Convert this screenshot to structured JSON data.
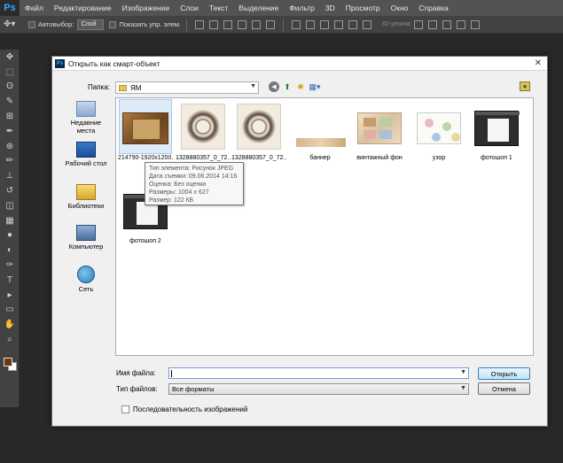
{
  "app": {
    "logo": "Ps",
    "menu": [
      "Файл",
      "Редактирование",
      "Изображение",
      "Слои",
      "Текст",
      "Выделение",
      "Фильтр",
      "3D",
      "Просмотр",
      "Окно",
      "Справка"
    ]
  },
  "options_bar": {
    "auto_select_label": "Автовыбор:",
    "auto_select_value": "Слой",
    "show_controls_label": "Показать упр. элем.",
    "mode_3d_label": "3D-режим:"
  },
  "tools": [
    "move-tool",
    "marquee-tool",
    "lasso-tool",
    "quick-select-tool",
    "crop-tool",
    "eyedropper-tool",
    "healing-tool",
    "brush-tool",
    "stamp-tool",
    "history-brush-tool",
    "eraser-tool",
    "gradient-tool",
    "blur-tool",
    "dodge-tool",
    "pen-tool",
    "type-tool",
    "path-select-tool",
    "shape-tool",
    "hand-tool",
    "zoom-tool"
  ],
  "tool_glyphs": [
    "✥",
    "⬚",
    "ʘ",
    "✎",
    "⊞",
    "✒",
    "⊕",
    "✏",
    "⊥",
    "↺",
    "◫",
    "▦",
    "●",
    "◐",
    "✑",
    "T",
    "▸",
    "▭",
    "✋",
    "⌕"
  ],
  "colors": {
    "foreground": "#6b3a10",
    "background": "#ffffff"
  },
  "dialog": {
    "title": "Открыть как смарт-объект",
    "folder_label": "Папка:",
    "folder_value": "ЯМ",
    "places": [
      {
        "label_line1": "Недавние",
        "label_line2": "места"
      },
      {
        "label_line1": "Рабочий стол",
        "label_line2": ""
      },
      {
        "label_line1": "Библиотеки",
        "label_line2": ""
      },
      {
        "label_line1": "Компьютер",
        "label_line2": ""
      },
      {
        "label_line1": "Сеть",
        "label_line2": ""
      }
    ],
    "files": [
      "214790-1920x1200...",
      "1328880357_0_72...",
      "1328880357_0_72...",
      "баннер",
      "винтажный фон",
      "узор",
      "фотошоп 1",
      "фотошоп 2"
    ],
    "tooltip": {
      "type": "Тип элемента: Рисунок JPEG",
      "date": "Дата съемки: 09.06.2014 14:16",
      "rating": "Оценка: Без оценки",
      "dimensions": "Размеры: 1004 x 627",
      "size": "Размер: 122 КБ"
    },
    "filename_label": "Имя файла:",
    "filename_value": "",
    "filetype_label": "Тип файлов:",
    "filetype_value": "Все форматы",
    "open_button": "Открыть",
    "cancel_button": "Отмена",
    "sequence_label": "Последовательность изображений"
  }
}
